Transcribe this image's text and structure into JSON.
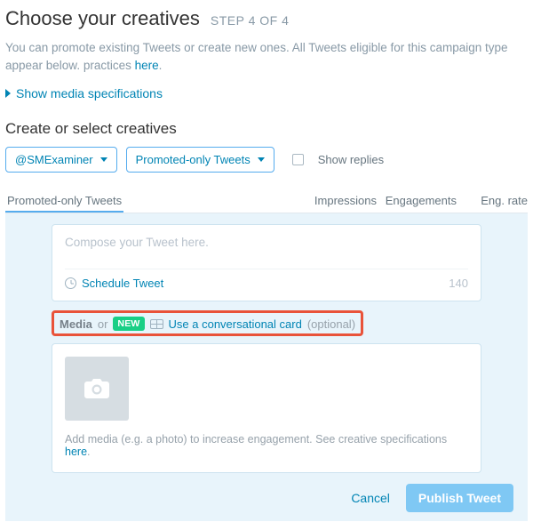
{
  "header": {
    "title": "Choose your creatives",
    "step": "STEP 4 OF 4"
  },
  "intro": {
    "text_before": "You can promote existing Tweets or create new ones. All Tweets eligible for this campaign type appear below. practices ",
    "link": "here",
    "text_after": "."
  },
  "spec_toggle": "Show media specifications",
  "section_heading": "Create or select creatives",
  "filters": {
    "account_label": "@SMExaminer",
    "tweet_type_label": "Promoted-only Tweets",
    "show_replies_label": "Show replies"
  },
  "columns": {
    "main": "Promoted-only Tweets",
    "impressions": "Impressions",
    "engagements": "Engagements",
    "eng_rate": "Eng. rate"
  },
  "composer": {
    "placeholder": "Compose your Tweet here.",
    "schedule_label": "Schedule Tweet",
    "char_count": "140"
  },
  "media_line": {
    "media": "Media",
    "or": "or",
    "new_badge": "NEW",
    "conv_link": "Use a conversational card",
    "optional": "(optional)"
  },
  "media_box": {
    "helper_before": "Add media (e.g. a photo) to increase engagement. See creative specifications ",
    "helper_link": "here",
    "helper_after": "."
  },
  "actions": {
    "cancel": "Cancel",
    "publish": "Publish Tweet"
  }
}
